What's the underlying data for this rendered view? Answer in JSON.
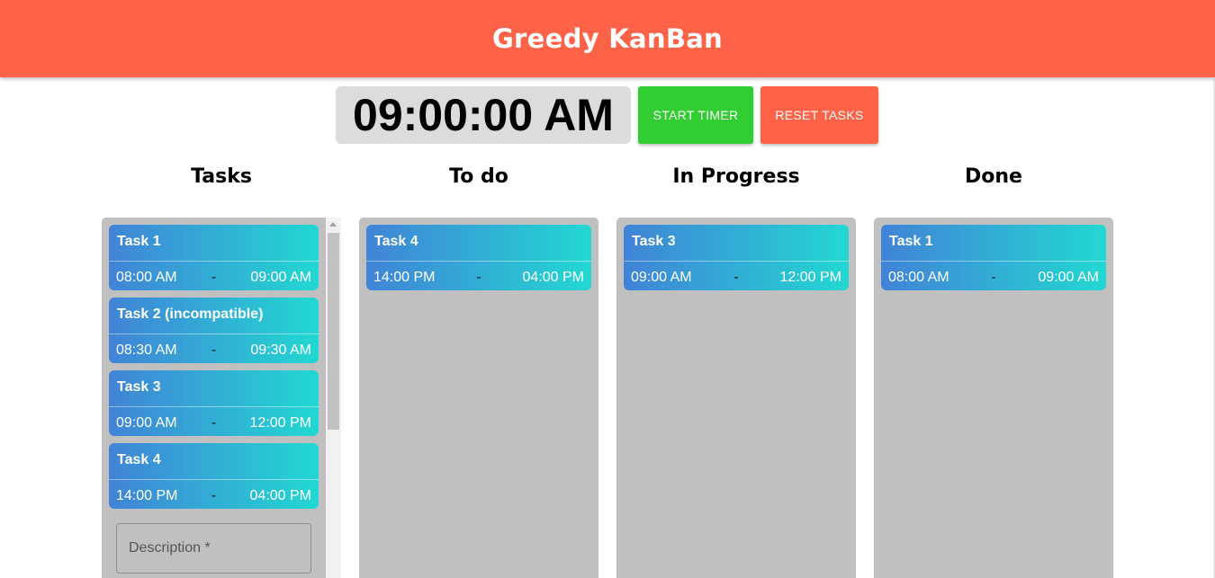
{
  "header": {
    "title": "Greedy KanBan"
  },
  "timer": {
    "display": "09:00:00 AM"
  },
  "controls": {
    "start_label": "START TIMER",
    "reset_label": "RESET TASKS"
  },
  "columns": [
    {
      "title": "Tasks",
      "cards": [
        {
          "title": "Task 1",
          "start": "08:00 AM",
          "sep": "-",
          "end": "09:00 AM"
        },
        {
          "title": "Task 2 (incompatible)",
          "start": "08:30 AM",
          "sep": "-",
          "end": "09:30 AM"
        },
        {
          "title": "Task 3",
          "start": "09:00 AM",
          "sep": "-",
          "end": "12:00 PM"
        },
        {
          "title": "Task 4",
          "start": "14:00 PM",
          "sep": "-",
          "end": "04:00 PM"
        }
      ],
      "description_placeholder": "Description *"
    },
    {
      "title": "To do",
      "cards": [
        {
          "title": "Task 4",
          "start": "14:00 PM",
          "sep": "-",
          "end": "04:00 PM"
        }
      ]
    },
    {
      "title": "In Progress",
      "cards": [
        {
          "title": "Task 3",
          "start": "09:00 AM",
          "sep": "-",
          "end": "12:00 PM"
        }
      ]
    },
    {
      "title": "Done",
      "cards": [
        {
          "title": "Task 1",
          "start": "08:00 AM",
          "sep": "-",
          "end": "09:00 AM"
        }
      ]
    }
  ],
  "colors": {
    "header": "#ff6347",
    "start_button": "#32cd32",
    "reset_button": "#ff6347",
    "column_bg": "#c0c0c0",
    "card_gradient_start": "#4183d7",
    "card_gradient_end": "#22d8d2"
  }
}
